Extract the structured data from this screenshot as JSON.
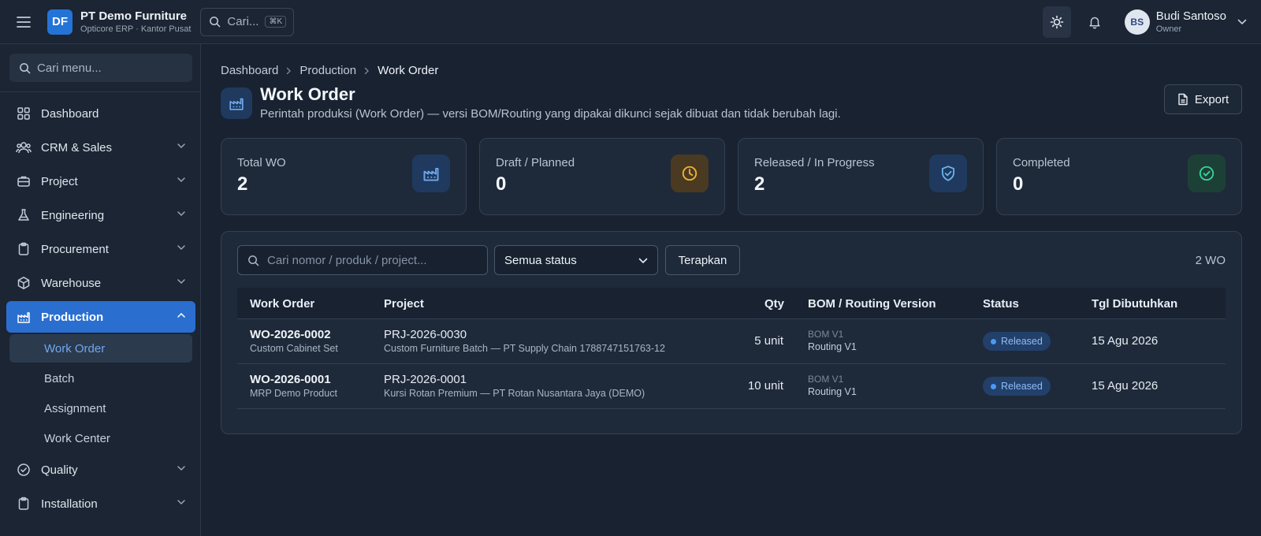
{
  "header": {
    "logo_initials": "DF",
    "brand_name": "PT Demo Furniture",
    "brand_sub": "Opticore ERP · Kantor Pusat",
    "search_label": "Cari...",
    "search_kbd": "⌘K",
    "user_initials": "BS",
    "user_name": "Budi Santoso",
    "user_role": "Owner"
  },
  "sidebar": {
    "search_placeholder": "Cari menu...",
    "items": [
      {
        "label": "Dashboard",
        "icon": "grid-icon"
      },
      {
        "label": "CRM & Sales",
        "icon": "users-icon"
      },
      {
        "label": "Project",
        "icon": "briefcase-icon"
      },
      {
        "label": "Engineering",
        "icon": "flask-icon"
      },
      {
        "label": "Procurement",
        "icon": "clipboard-icon"
      },
      {
        "label": "Warehouse",
        "icon": "box-icon"
      },
      {
        "label": "Production",
        "icon": "factory-icon",
        "active": true
      },
      {
        "label": "Quality",
        "icon": "check-circle-icon"
      },
      {
        "label": "Installation",
        "icon": "clipboard-icon"
      }
    ],
    "production_sub": [
      "Work Order",
      "Batch",
      "Assignment",
      "Work Center"
    ]
  },
  "breadcrumb": [
    "Dashboard",
    "Production",
    "Work Order"
  ],
  "page": {
    "title": "Work Order",
    "description": "Perintah produksi (Work Order) — versi BOM/Routing yang dipakai dikunci sejak dibuat dan tidak berubah lagi.",
    "export_label": "Export"
  },
  "stats": [
    {
      "label": "Total WO",
      "value": "2",
      "icon": "factory-icon",
      "icon_color": "#6fa8ef",
      "bg": "#1f3a5e"
    },
    {
      "label": "Draft / Planned",
      "value": "0",
      "icon": "clock-icon",
      "icon_color": "#f2b233",
      "bg": "#4a3a22"
    },
    {
      "label": "Released / In Progress",
      "value": "2",
      "icon": "shield-check-icon",
      "icon_color": "#6fb4f2",
      "bg": "#1f3a5e"
    },
    {
      "label": "Completed",
      "value": "0",
      "icon": "check-circle-icon",
      "icon_color": "#34d399",
      "bg": "#1d4036"
    }
  ],
  "filters": {
    "search_placeholder": "Cari nomor / produk / project...",
    "status_value": "Semua status",
    "apply_label": "Terapkan",
    "count": "2 WO"
  },
  "table": {
    "headers": [
      "Work Order",
      "Project",
      "Qty",
      "BOM / Routing Version",
      "Status",
      "Tgl Dibutuhkan"
    ],
    "rows": [
      {
        "wo": "WO-2026-0002",
        "product": "Custom Cabinet Set",
        "project": "PRJ-2026-0030",
        "project_desc": "Custom Furniture Batch — PT Supply Chain 1788747151763-12",
        "qty": "5 unit",
        "bom": "BOM V1",
        "routing": "Routing V1",
        "status": "Released",
        "date": "15 Agu 2026"
      },
      {
        "wo": "WO-2026-0001",
        "product": "MRP Demo Product",
        "project": "PRJ-2026-0001",
        "project_desc": "Kursi Rotan Premium — PT Rotan Nusantara Jaya (DEMO)",
        "qty": "10 unit",
        "bom": "BOM V1",
        "routing": "Routing V1",
        "status": "Released",
        "date": "15 Agu 2026"
      }
    ]
  },
  "colors": {
    "accent": "#2a6fd0",
    "badge_bg": "#22406a",
    "badge_text": "#8fbdf6"
  }
}
